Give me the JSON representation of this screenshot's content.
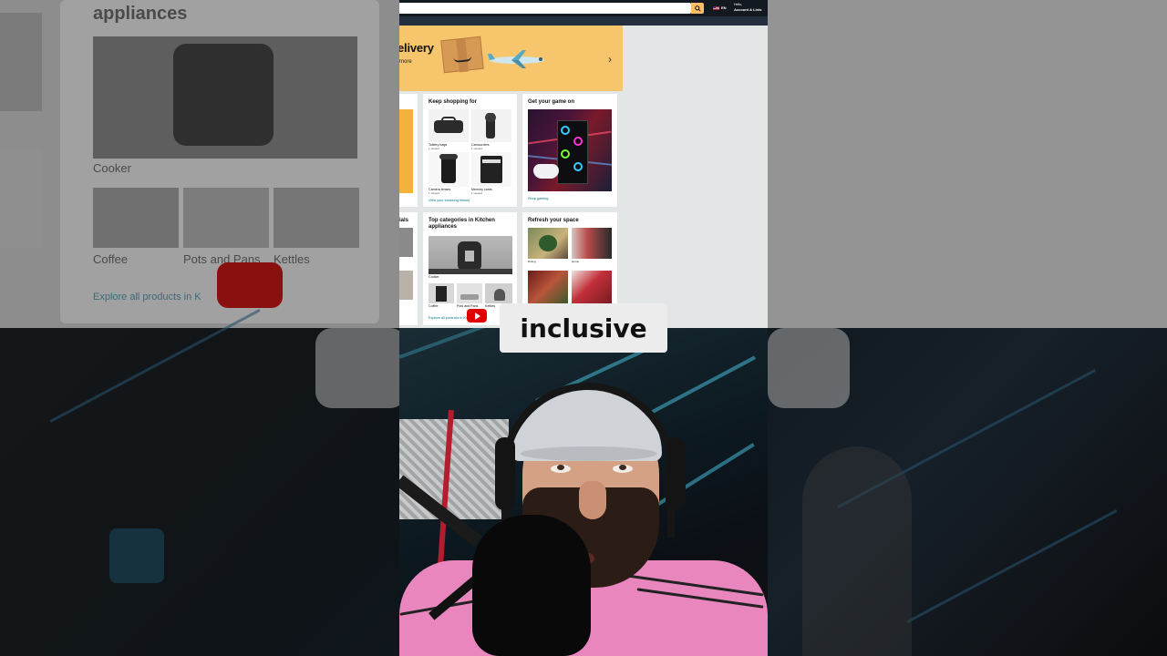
{
  "nav": {
    "language": "EN",
    "account_hello": "Hello, ",
    "account_lists": "Account & Lists",
    "subnav_right": "Get fr"
  },
  "hero": {
    "title": "elivery",
    "subtitle": "more"
  },
  "keep_shopping": {
    "title": "Keep shopping for",
    "items": [
      {
        "label": "Toiletry bags",
        "sub": "1 viewed"
      },
      {
        "label": "Camcorders",
        "sub": "1 viewed"
      },
      {
        "label": "Camera lenses",
        "sub": "1 viewed"
      },
      {
        "label": "Memory cards",
        "sub": "1 viewed"
      }
    ],
    "link": "View your browsing history"
  },
  "game": {
    "title": "Get your game on",
    "link": "Shop gaming"
  },
  "left_card": {
    "title": "ials"
  },
  "kitchen": {
    "title": "Top categories in Kitchen appliances",
    "main_label": "Cooker",
    "items": [
      {
        "label": "Coffee"
      },
      {
        "label": "Pots and Pans"
      },
      {
        "label": "Kettles"
      }
    ],
    "link": "Explore all products in Kitchen"
  },
  "refresh": {
    "title": "Refresh your space",
    "items": [
      {
        "label": "Dining"
      },
      {
        "label": "Home"
      }
    ]
  },
  "caption": "inclusive",
  "background": {
    "heading": "appliances",
    "cooker": "Cooker",
    "coffee": "Coffee",
    "pots": "Pots and Pans",
    "kettles": "Kettles",
    "explore": "Explore all products in K"
  },
  "colors": {
    "nav": "#131921",
    "search_button": "#febd69",
    "hero": "#f7c56b",
    "link": "#007185",
    "youtube": "#e00000",
    "shirt": "#e986bd"
  }
}
